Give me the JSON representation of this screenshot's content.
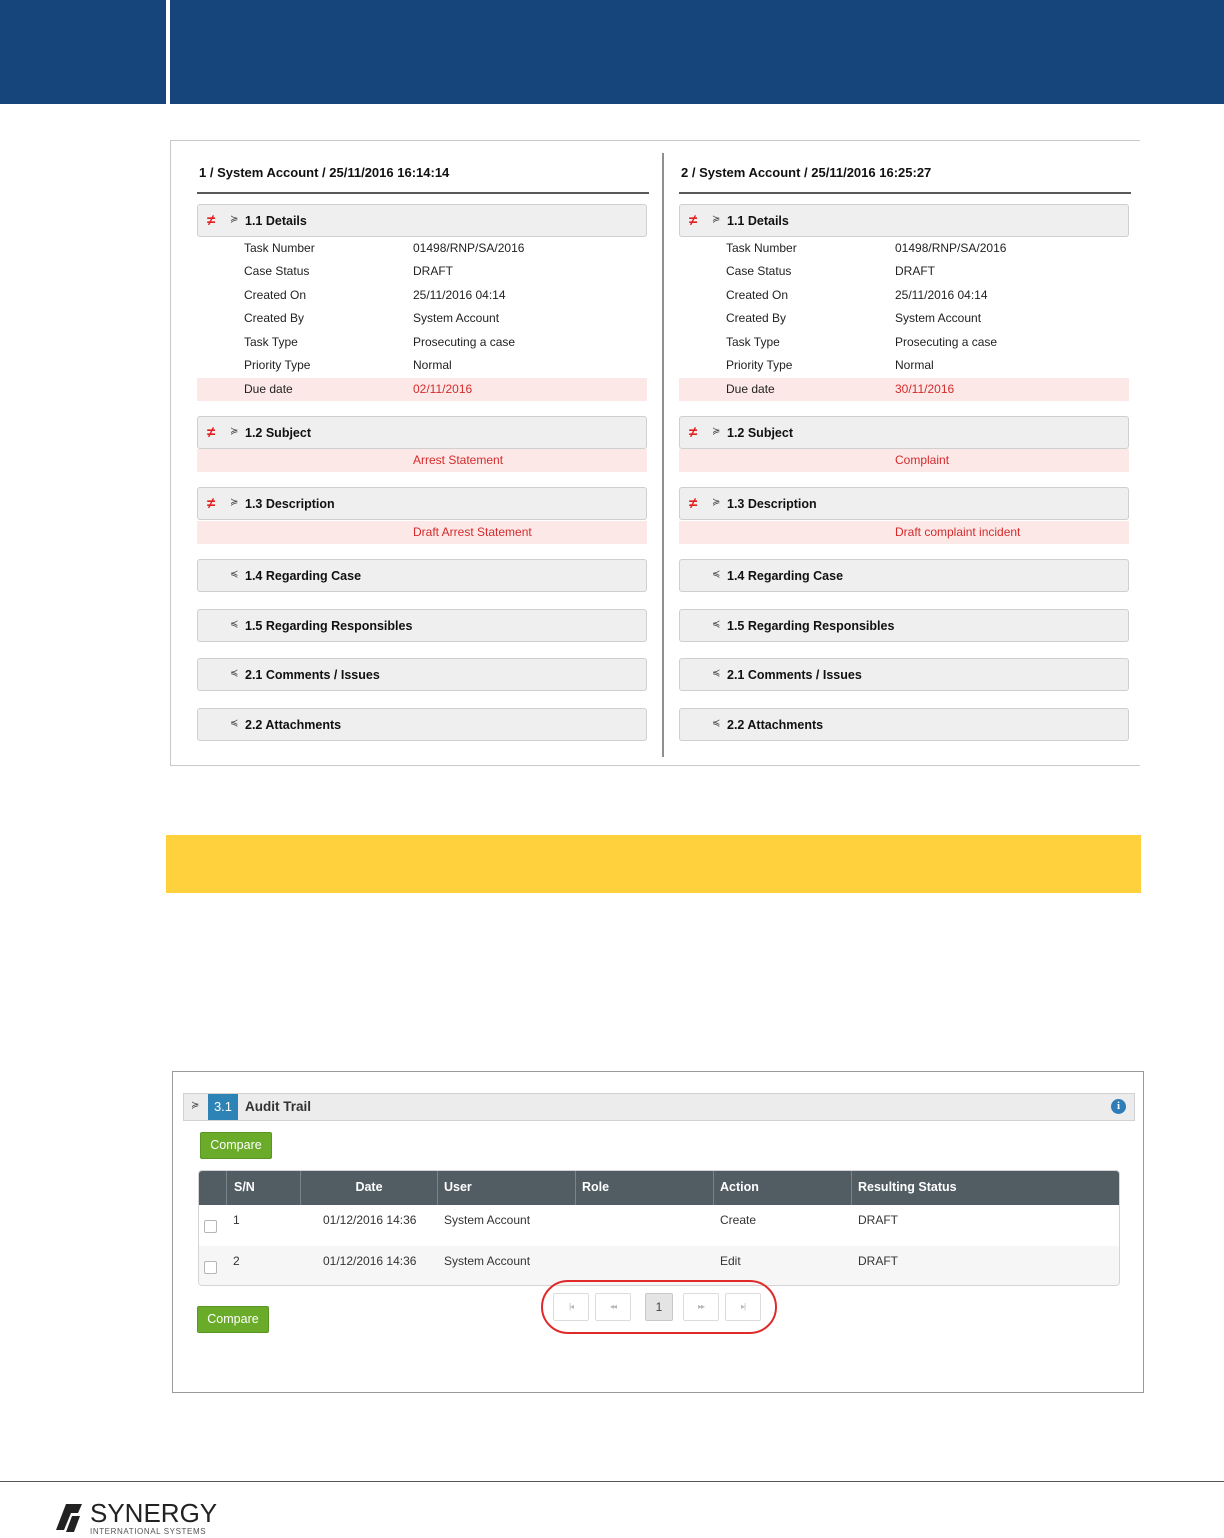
{
  "compare": {
    "left": {
      "title": "1 / System Account / 25/11/2016 16:14:14",
      "details": {
        "label": "1.1 Details",
        "rows": [
          {
            "key": "Task Number",
            "value": "01498/RNP/SA/2016"
          },
          {
            "key": "Case Status",
            "value": "DRAFT"
          },
          {
            "key": "Created On",
            "value": "25/11/2016 04:14"
          },
          {
            "key": "Created By",
            "value": "System Account"
          },
          {
            "key": "Task Type",
            "value": "Prosecuting a case"
          },
          {
            "key": "Priority Type",
            "value": "Normal"
          },
          {
            "key": "Due date",
            "value": "02/11/2016"
          }
        ]
      },
      "subject": {
        "label": "1.2 Subject",
        "value": "Arrest Statement"
      },
      "description": {
        "label": "1.3 Description",
        "value": "Draft Arrest Statement"
      },
      "collapsed": [
        "1.4 Regarding Case",
        "1.5 Regarding Responsibles",
        "2.1 Comments / Issues",
        "2.2 Attachments"
      ]
    },
    "right": {
      "title": "2 / System Account / 25/11/2016 16:25:27",
      "details": {
        "label": "1.1 Details",
        "rows": [
          {
            "key": "Task Number",
            "value": "01498/RNP/SA/2016"
          },
          {
            "key": "Case Status",
            "value": "DRAFT"
          },
          {
            "key": "Created On",
            "value": "25/11/2016 04:14"
          },
          {
            "key": "Created By",
            "value": "System Account"
          },
          {
            "key": "Task Type",
            "value": "Prosecuting a case"
          },
          {
            "key": "Priority Type",
            "value": "Normal"
          },
          {
            "key": "Due date",
            "value": "30/11/2016"
          }
        ]
      },
      "subject": {
        "label": "1.2 Subject",
        "value": "Complaint"
      },
      "description": {
        "label": "1.3 Description",
        "value": "Draft complaint incident"
      },
      "collapsed": [
        "1.4 Regarding Case",
        "1.5 Regarding Responsibles",
        "2.1 Comments / Issues",
        "2.2 Attachments"
      ]
    },
    "diff_symbol": "≠",
    "expanded_chevron": "≽",
    "collapsed_chevron": "≼"
  },
  "audit": {
    "section_number": "3.1",
    "section_title": "Audit Trail",
    "info_icon": "i",
    "compare_label": "Compare",
    "columns": [
      "S/N",
      "Date",
      "User",
      "Role",
      "Action",
      "Resulting Status"
    ],
    "rows": [
      {
        "sn": "1",
        "date": "01/12/2016 14:36",
        "user": "System Account",
        "role": "",
        "action": "Create",
        "status": "DRAFT"
      },
      {
        "sn": "2",
        "date": "01/12/2016 14:36",
        "user": "System Account",
        "role": "",
        "action": "Edit",
        "status": "DRAFT"
      }
    ],
    "pager": {
      "first": "|◂",
      "prev": "◂◂",
      "current": "1",
      "next": "▸▸",
      "last": "▸|"
    }
  },
  "footer": {
    "brand": "SYNERGY",
    "tagline": "INTERNATIONAL SYSTEMS"
  },
  "colors": {
    "header_blue": "#15457a",
    "highlight_yellow": "#ffd23d",
    "diff_red": "#d42b2b",
    "button_green": "#6aac2a",
    "table_header": "#525d63",
    "section_badge": "#2e83b6"
  }
}
